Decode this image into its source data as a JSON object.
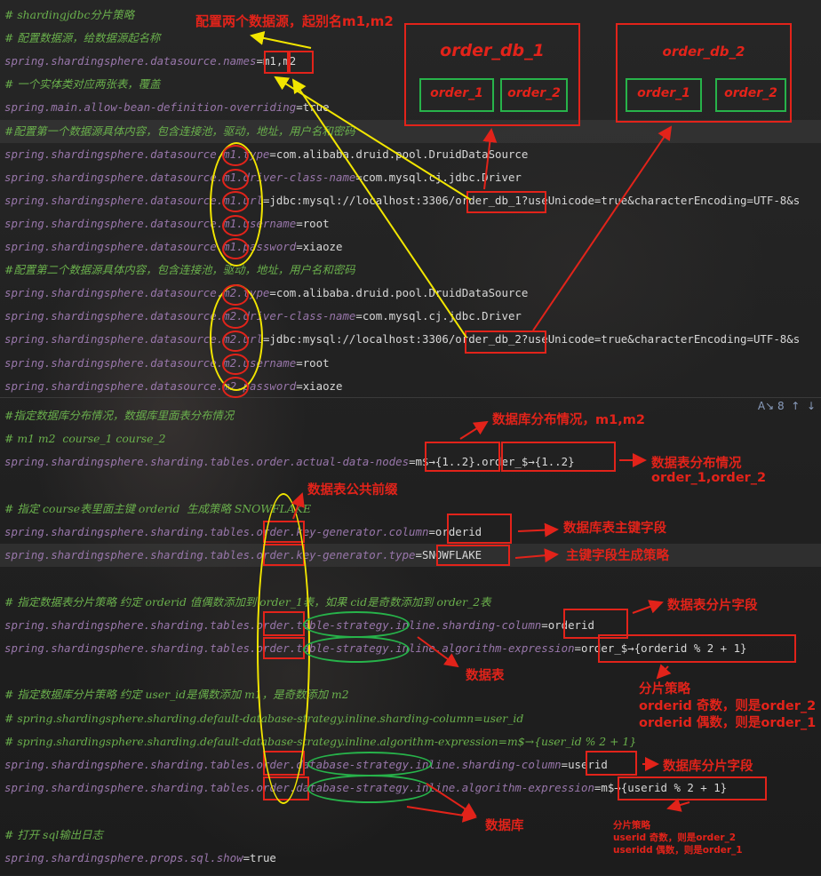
{
  "top_lines": [
    {
      "parts": [
        [
          "cm",
          "# shardingjdbc分片策略"
        ]
      ]
    },
    {
      "parts": [
        [
          "cm",
          "# 配置数据源，给数据源起名称"
        ]
      ]
    },
    {
      "parts": [
        [
          "k",
          "spring.shardingsphere.datasource.names"
        ],
        [
          "eq",
          "="
        ],
        [
          "v",
          "m1,m2"
        ]
      ]
    },
    {
      "parts": [
        [
          "cm",
          "# 一个实体类对应两张表，覆盖"
        ]
      ]
    },
    {
      "parts": [
        [
          "k",
          "spring.main.allow-bean-definition-overriding"
        ],
        [
          "eq",
          "="
        ],
        [
          "v",
          "true"
        ]
      ]
    },
    {
      "parts": [
        [
          "cm",
          "#配置第一个数据源具体内容，包含连接池，驱动，地址，用户名和密码"
        ]
      ],
      "hl": true
    },
    {
      "parts": [
        [
          "k",
          "spring.shardingsphere.datasource.m1.type"
        ],
        [
          "eq",
          "="
        ],
        [
          "v",
          "com.alibaba.druid.pool.DruidDataSource"
        ]
      ]
    },
    {
      "parts": [
        [
          "k",
          "spring.shardingsphere.datasource.m1.driver-class-name"
        ],
        [
          "eq",
          "="
        ],
        [
          "v",
          "com.mysql.cj.jdbc.Driver"
        ]
      ]
    },
    {
      "parts": [
        [
          "k",
          "spring.shardingsphere.datasource.m1.url"
        ],
        [
          "eq",
          "="
        ],
        [
          "v",
          "jdbc:mysql://localhost:3306/order_db_1?useUnicode=true&characterEncoding=UTF-8&s"
        ]
      ]
    },
    {
      "parts": [
        [
          "k",
          "spring.shardingsphere.datasource.m1.username"
        ],
        [
          "eq",
          "="
        ],
        [
          "v",
          "root"
        ]
      ]
    },
    {
      "parts": [
        [
          "k",
          "spring.shardingsphere.datasource.m1.password"
        ],
        [
          "eq",
          "="
        ],
        [
          "v",
          "xiaoze"
        ]
      ]
    },
    {
      "parts": [
        [
          "cm",
          "#配置第二个数据源具体内容，包含连接池，驱动，地址，用户名和密码"
        ]
      ]
    },
    {
      "parts": [
        [
          "k",
          "spring.shardingsphere.datasource.m2.type"
        ],
        [
          "eq",
          "="
        ],
        [
          "v",
          "com.alibaba.druid.pool.DruidDataSource"
        ]
      ]
    },
    {
      "parts": [
        [
          "k",
          "spring.shardingsphere.datasource.m2.driver-class-name"
        ],
        [
          "eq",
          "="
        ],
        [
          "v",
          "com.mysql.cj.jdbc.Driver"
        ]
      ]
    },
    {
      "parts": [
        [
          "k",
          "spring.shardingsphere.datasource.m2.url"
        ],
        [
          "eq",
          "="
        ],
        [
          "v",
          "jdbc:mysql://localhost:3306/order_db_2?useUnicode=true&characterEncoding=UTF-8&s"
        ]
      ]
    },
    {
      "parts": [
        [
          "k",
          "spring.shardingsphere.datasource.m2.username"
        ],
        [
          "eq",
          "="
        ],
        [
          "v",
          "root"
        ]
      ]
    },
    {
      "parts": [
        [
          "k",
          "spring.shardingsphere.datasource.m2.password"
        ],
        [
          "eq",
          "="
        ],
        [
          "v",
          "xiaoze"
        ]
      ]
    }
  ],
  "bottom_lines": [
    {
      "parts": [
        [
          "cm",
          "#指定数据库分布情况，数据库里面表分布情况"
        ]
      ]
    },
    {
      "parts": [
        [
          "cm",
          "# m1 m2  course_1 course_2"
        ]
      ]
    },
    {
      "parts": [
        [
          "k",
          "spring.shardingsphere.sharding.tables.order.actual-data-nodes"
        ],
        [
          "eq",
          "="
        ],
        [
          "v",
          "m$→{1..2}.order_$→{1..2}"
        ]
      ]
    },
    {
      "parts": [
        [
          "cm",
          ""
        ]
      ]
    },
    {
      "parts": [
        [
          "cm",
          "# 指定 course表里面主键 orderid  生成策略 SNOWFLAKE"
        ]
      ]
    },
    {
      "parts": [
        [
          "k",
          "spring.shardingsphere.sharding.tables.order.key-generator.column"
        ],
        [
          "eq",
          "="
        ],
        [
          "v",
          "orderid"
        ]
      ]
    },
    {
      "parts": [
        [
          "k",
          "spring.shardingsphere.sharding.tables.order.key-generator.type"
        ],
        [
          "eq",
          "="
        ],
        [
          "v",
          "SNOWFLAKE"
        ]
      ],
      "hl": true
    },
    {
      "parts": [
        [
          "cm",
          ""
        ]
      ]
    },
    {
      "parts": [
        [
          "cm",
          "# 指定数据表分片策略 约定 orderid 值偶数添加到 order_1表，如果 cid是奇数添加到 order_2表"
        ]
      ]
    },
    {
      "parts": [
        [
          "k",
          "spring.shardingsphere.sharding.tables.order.table-strategy.inline.sharding-column"
        ],
        [
          "eq",
          "="
        ],
        [
          "v",
          "orderid"
        ]
      ]
    },
    {
      "parts": [
        [
          "k",
          "spring.shardingsphere.sharding.tables.order.table-strategy.inline.algorithm-expression"
        ],
        [
          "eq",
          "="
        ],
        [
          "v",
          "order_$→{orderid % 2 + 1}"
        ]
      ]
    },
    {
      "parts": [
        [
          "cm",
          ""
        ]
      ]
    },
    {
      "parts": [
        [
          "cm",
          "# 指定数据库分片策略 约定 user_id是偶数添加 m1，是奇数添加 m2"
        ]
      ]
    },
    {
      "parts": [
        [
          "cm",
          "# spring.shardingsphere.sharding.default-database-strategy.inline.sharding-column=user_id"
        ]
      ]
    },
    {
      "parts": [
        [
          "cm",
          "# spring.shardingsphere.sharding.default-database-strategy.inline.algorithm-expression=m$→{user_id % 2 + 1}"
        ]
      ]
    },
    {
      "parts": [
        [
          "k",
          "spring.shardingsphere.sharding.tables.order.database-strategy.inline.sharding-column"
        ],
        [
          "eq",
          "="
        ],
        [
          "v",
          "userid"
        ]
      ]
    },
    {
      "parts": [
        [
          "k",
          "spring.shardingsphere.sharding.tables.order.database-strategy.inline.algorithm-expression"
        ],
        [
          "eq",
          "="
        ],
        [
          "v",
          "m$→{userid % 2 + 1}"
        ]
      ]
    },
    {
      "parts": [
        [
          "cm",
          ""
        ]
      ]
    },
    {
      "parts": [
        [
          "cm",
          "# 打开 sql输出日志"
        ]
      ]
    },
    {
      "parts": [
        [
          "k",
          "spring.shardingsphere.props.sql.show"
        ],
        [
          "eq",
          "="
        ],
        [
          "v",
          "true"
        ]
      ]
    }
  ],
  "editor_toolbar": {
    "hint_count": "8",
    "icon_names": [
      "inspection-icon",
      "arrow-up-icon",
      "arrow-down-icon"
    ]
  },
  "diagram": {
    "db1_title": "order_db_1",
    "db1_tables": [
      "order_1",
      "order_2"
    ],
    "db2_title": "order_db_2",
    "db2_tables": [
      "order_1",
      "order_2"
    ]
  },
  "annotations": {
    "datasource_names": "配置两个数据源，起别名m1,m2",
    "db_distribution": "数据库分布情况，m1,m2",
    "table_distribution_1": "数据表分布情况",
    "table_distribution_2": "order_1,order_2",
    "table_prefix": "数据表公共前缀",
    "pk_field": "数据库表主键字段",
    "pk_strategy": "主键字段生成策略",
    "table_shard_field": "数据表分片字段",
    "table_label": "数据表",
    "shard_strategy_title": "分片策略",
    "shard_strategy_odd": "orderid 奇数，则是order_2",
    "shard_strategy_even": "orderid 偶数，则是order_1",
    "db_shard_field": "数据库分片字段",
    "db_label": "数据库",
    "small_strategy_title": "分片策略",
    "small_strategy_odd": "userid 奇数，则是order_2",
    "small_strategy_even": "useridd 偶数，则是order_1"
  },
  "colors": {
    "accent_red": "#e2231a",
    "accent_green": "#27b34a",
    "accent_yellow": "#f2e600",
    "comment_green": "#6ab04c",
    "key_purple": "#9876aa"
  }
}
